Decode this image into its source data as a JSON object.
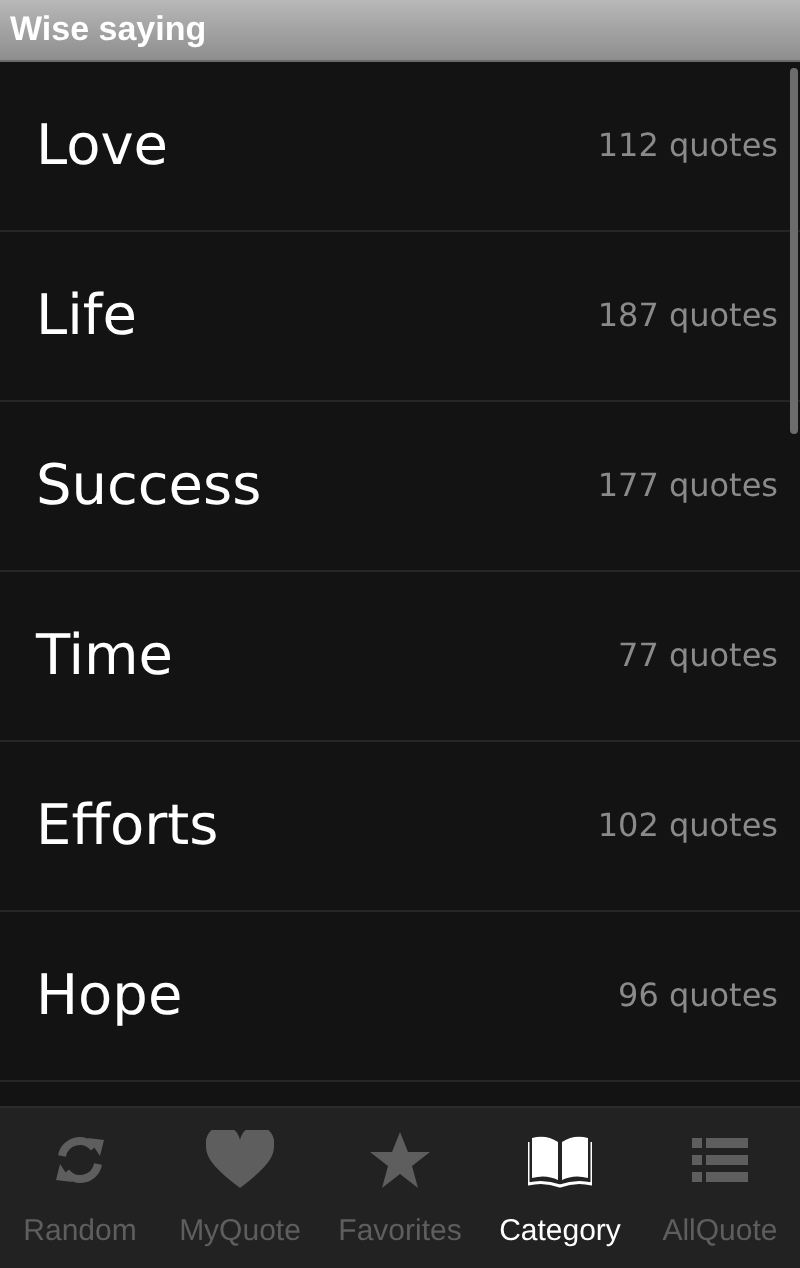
{
  "window": {
    "title": "Wise saying"
  },
  "categories": [
    {
      "name": "Love",
      "count": "112 quotes"
    },
    {
      "name": "Life",
      "count": "187 quotes"
    },
    {
      "name": "Success",
      "count": "177 quotes"
    },
    {
      "name": "Time",
      "count": "77 quotes"
    },
    {
      "name": "Efforts",
      "count": "102 quotes"
    },
    {
      "name": "Hope",
      "count": "96 quotes"
    }
  ],
  "tabs": [
    {
      "label": "Random",
      "selected": false
    },
    {
      "label": "MyQuote",
      "selected": false
    },
    {
      "label": "Favorites",
      "selected": false
    },
    {
      "label": "Category",
      "selected": true
    },
    {
      "label": "AllQuote",
      "selected": false
    }
  ]
}
